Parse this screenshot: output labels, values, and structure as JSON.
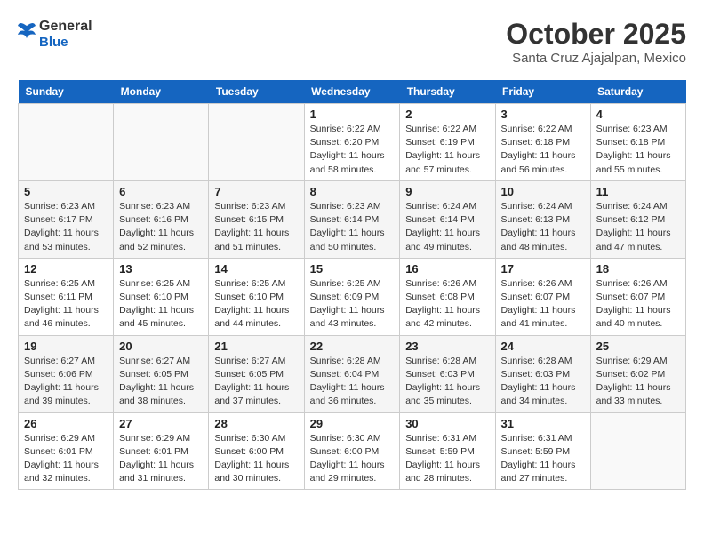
{
  "header": {
    "logo_line1": "General",
    "logo_line2": "Blue",
    "month": "October 2025",
    "location": "Santa Cruz Ajajalpan, Mexico"
  },
  "weekdays": [
    "Sunday",
    "Monday",
    "Tuesday",
    "Wednesday",
    "Thursday",
    "Friday",
    "Saturday"
  ],
  "weeks": [
    [
      {
        "day": "",
        "info": ""
      },
      {
        "day": "",
        "info": ""
      },
      {
        "day": "",
        "info": ""
      },
      {
        "day": "1",
        "info": "Sunrise: 6:22 AM\nSunset: 6:20 PM\nDaylight: 11 hours and 58 minutes."
      },
      {
        "day": "2",
        "info": "Sunrise: 6:22 AM\nSunset: 6:19 PM\nDaylight: 11 hours and 57 minutes."
      },
      {
        "day": "3",
        "info": "Sunrise: 6:22 AM\nSunset: 6:18 PM\nDaylight: 11 hours and 56 minutes."
      },
      {
        "day": "4",
        "info": "Sunrise: 6:23 AM\nSunset: 6:18 PM\nDaylight: 11 hours and 55 minutes."
      }
    ],
    [
      {
        "day": "5",
        "info": "Sunrise: 6:23 AM\nSunset: 6:17 PM\nDaylight: 11 hours and 53 minutes."
      },
      {
        "day": "6",
        "info": "Sunrise: 6:23 AM\nSunset: 6:16 PM\nDaylight: 11 hours and 52 minutes."
      },
      {
        "day": "7",
        "info": "Sunrise: 6:23 AM\nSunset: 6:15 PM\nDaylight: 11 hours and 51 minutes."
      },
      {
        "day": "8",
        "info": "Sunrise: 6:23 AM\nSunset: 6:14 PM\nDaylight: 11 hours and 50 minutes."
      },
      {
        "day": "9",
        "info": "Sunrise: 6:24 AM\nSunset: 6:14 PM\nDaylight: 11 hours and 49 minutes."
      },
      {
        "day": "10",
        "info": "Sunrise: 6:24 AM\nSunset: 6:13 PM\nDaylight: 11 hours and 48 minutes."
      },
      {
        "day": "11",
        "info": "Sunrise: 6:24 AM\nSunset: 6:12 PM\nDaylight: 11 hours and 47 minutes."
      }
    ],
    [
      {
        "day": "12",
        "info": "Sunrise: 6:25 AM\nSunset: 6:11 PM\nDaylight: 11 hours and 46 minutes."
      },
      {
        "day": "13",
        "info": "Sunrise: 6:25 AM\nSunset: 6:10 PM\nDaylight: 11 hours and 45 minutes."
      },
      {
        "day": "14",
        "info": "Sunrise: 6:25 AM\nSunset: 6:10 PM\nDaylight: 11 hours and 44 minutes."
      },
      {
        "day": "15",
        "info": "Sunrise: 6:25 AM\nSunset: 6:09 PM\nDaylight: 11 hours and 43 minutes."
      },
      {
        "day": "16",
        "info": "Sunrise: 6:26 AM\nSunset: 6:08 PM\nDaylight: 11 hours and 42 minutes."
      },
      {
        "day": "17",
        "info": "Sunrise: 6:26 AM\nSunset: 6:07 PM\nDaylight: 11 hours and 41 minutes."
      },
      {
        "day": "18",
        "info": "Sunrise: 6:26 AM\nSunset: 6:07 PM\nDaylight: 11 hours and 40 minutes."
      }
    ],
    [
      {
        "day": "19",
        "info": "Sunrise: 6:27 AM\nSunset: 6:06 PM\nDaylight: 11 hours and 39 minutes."
      },
      {
        "day": "20",
        "info": "Sunrise: 6:27 AM\nSunset: 6:05 PM\nDaylight: 11 hours and 38 minutes."
      },
      {
        "day": "21",
        "info": "Sunrise: 6:27 AM\nSunset: 6:05 PM\nDaylight: 11 hours and 37 minutes."
      },
      {
        "day": "22",
        "info": "Sunrise: 6:28 AM\nSunset: 6:04 PM\nDaylight: 11 hours and 36 minutes."
      },
      {
        "day": "23",
        "info": "Sunrise: 6:28 AM\nSunset: 6:03 PM\nDaylight: 11 hours and 35 minutes."
      },
      {
        "day": "24",
        "info": "Sunrise: 6:28 AM\nSunset: 6:03 PM\nDaylight: 11 hours and 34 minutes."
      },
      {
        "day": "25",
        "info": "Sunrise: 6:29 AM\nSunset: 6:02 PM\nDaylight: 11 hours and 33 minutes."
      }
    ],
    [
      {
        "day": "26",
        "info": "Sunrise: 6:29 AM\nSunset: 6:01 PM\nDaylight: 11 hours and 32 minutes."
      },
      {
        "day": "27",
        "info": "Sunrise: 6:29 AM\nSunset: 6:01 PM\nDaylight: 11 hours and 31 minutes."
      },
      {
        "day": "28",
        "info": "Sunrise: 6:30 AM\nSunset: 6:00 PM\nDaylight: 11 hours and 30 minutes."
      },
      {
        "day": "29",
        "info": "Sunrise: 6:30 AM\nSunset: 6:00 PM\nDaylight: 11 hours and 29 minutes."
      },
      {
        "day": "30",
        "info": "Sunrise: 6:31 AM\nSunset: 5:59 PM\nDaylight: 11 hours and 28 minutes."
      },
      {
        "day": "31",
        "info": "Sunrise: 6:31 AM\nSunset: 5:59 PM\nDaylight: 11 hours and 27 minutes."
      },
      {
        "day": "",
        "info": ""
      }
    ]
  ]
}
